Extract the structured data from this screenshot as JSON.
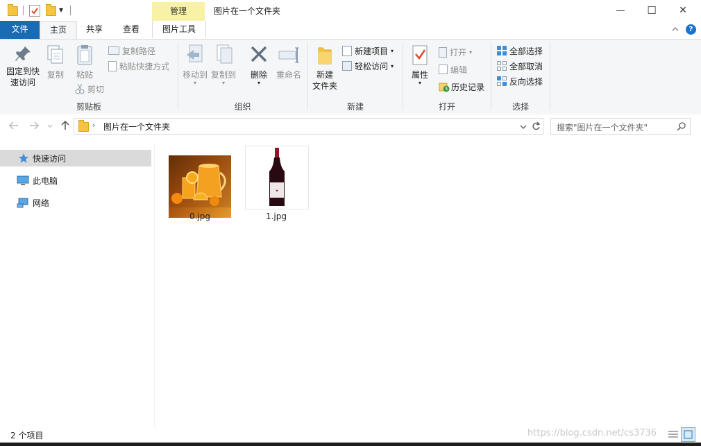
{
  "window": {
    "title": "图片在一个文件夹",
    "contextual_tab_group": "管理",
    "minimize_symbol": "—",
    "maximize_symbol": "☐",
    "close_symbol": "✕"
  },
  "quick_access_toolbar": {
    "dropdown_symbol": "▾"
  },
  "tabs": [
    {
      "label": "文件"
    },
    {
      "label": "主页"
    },
    {
      "label": "共享"
    },
    {
      "label": "查看"
    },
    {
      "label": "图片工具"
    }
  ],
  "ribbon": {
    "clipboard": {
      "group_label": "剪贴板",
      "pin_label_1": "固定到快",
      "pin_label_2": "速访问",
      "copy_label": "复制",
      "paste_label": "粘贴",
      "copy_path_label": "复制路径",
      "paste_shortcut_label": "粘贴快捷方式",
      "cut_label": "剪切"
    },
    "organize": {
      "group_label": "组织",
      "move_to_label": "移动到",
      "copy_to_label": "复制到",
      "delete_label": "删除",
      "rename_label": "重命名"
    },
    "new": {
      "group_label": "新建",
      "new_folder_label_1": "新建",
      "new_folder_label_2": "文件夹",
      "new_item_label": "新建项目",
      "easy_access_label": "轻松访问"
    },
    "open": {
      "group_label": "打开",
      "properties_label": "属性",
      "open_label": "打开",
      "edit_label": "编辑",
      "history_label": "历史记录"
    },
    "select": {
      "group_label": "选择",
      "select_all_label": "全部选择",
      "select_none_label": "全部取消",
      "invert_label": "反向选择"
    }
  },
  "address_bar": {
    "path": "图片在一个文件夹",
    "search_placeholder": "搜索\"图片在一个文件夹\""
  },
  "nav_pane": {
    "items": [
      {
        "label": "快速访问",
        "icon": "star-icon"
      },
      {
        "label": "此电脑",
        "icon": "computer-icon"
      },
      {
        "label": "网络",
        "icon": "network-icon"
      }
    ]
  },
  "files": [
    {
      "name": "0.jpg",
      "thumbnail": "orange-juice"
    },
    {
      "name": "1.jpg",
      "thumbnail": "wine-bottle"
    }
  ],
  "status_bar": {
    "item_count": "2 个项目",
    "watermark": "https://blog.csdn.net/cs3736"
  },
  "colors": {
    "accent": "#1a6bb5",
    "manage_tab": "#f8f2a6",
    "ribbon_bg": "#f5f6f7",
    "selected_nav": "#dadada"
  }
}
